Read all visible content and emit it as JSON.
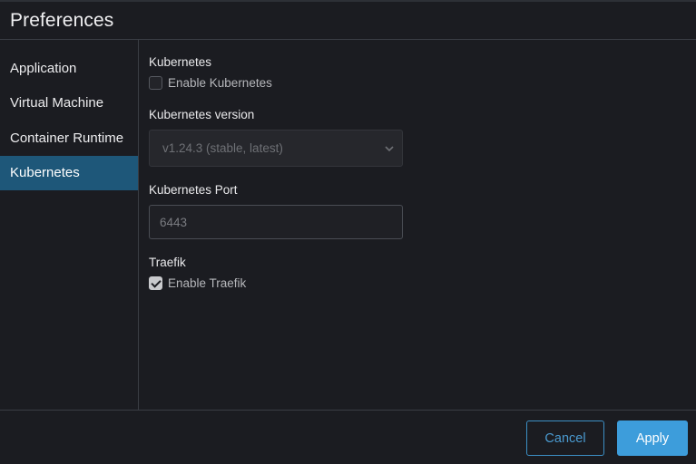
{
  "window": {
    "title": "Preferences"
  },
  "sidebar": {
    "items": [
      {
        "label": "Application",
        "active": false
      },
      {
        "label": "Virtual Machine",
        "active": false
      },
      {
        "label": "Container Runtime",
        "active": false
      },
      {
        "label": "Kubernetes",
        "active": true
      }
    ]
  },
  "kubernetes": {
    "enable_section_label": "Kubernetes",
    "enable_checkbox_label": "Enable Kubernetes",
    "enable_checked": false,
    "version_label": "Kubernetes version",
    "version_selected": "v1.24.3 (stable, latest)",
    "port_label": "Kubernetes Port",
    "port_value": "6443",
    "traefik_label": "Traefik",
    "traefik_checkbox_label": "Enable Traefik",
    "traefik_checked": true
  },
  "footer": {
    "cancel_label": "Cancel",
    "apply_label": "Apply"
  },
  "colors": {
    "accent": "#3d9ddb",
    "active_nav": "#1e5779",
    "background": "#1b1c21"
  }
}
